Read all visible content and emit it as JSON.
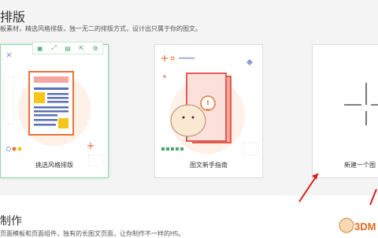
{
  "section1": {
    "title": "排版",
    "description": "板素材，精选风格排版，独一无二的排版方式，设计出只属于你的图文。"
  },
  "cards": [
    {
      "label": "挑选风格排版"
    },
    {
      "label": "图文新手指南"
    },
    {
      "label": "新建一个图"
    }
  ],
  "toolbar": {
    "icons": [
      "image-icon",
      "expand-icon",
      "save-icon",
      "export-icon",
      "settings-icon"
    ]
  },
  "section2": {
    "title": "制作",
    "description": "页面模板和页面组件，独有的长图文页面，让你制作不一样的H5。"
  },
  "watermark": {
    "text": "3DM"
  },
  "colors": {
    "accent_green": "#4aa86b",
    "arrow_red": "#d9201b",
    "doc_orange": "#e8743b",
    "doc_blue": "#5b6fb8",
    "doc_yellow": "#f5c518"
  }
}
